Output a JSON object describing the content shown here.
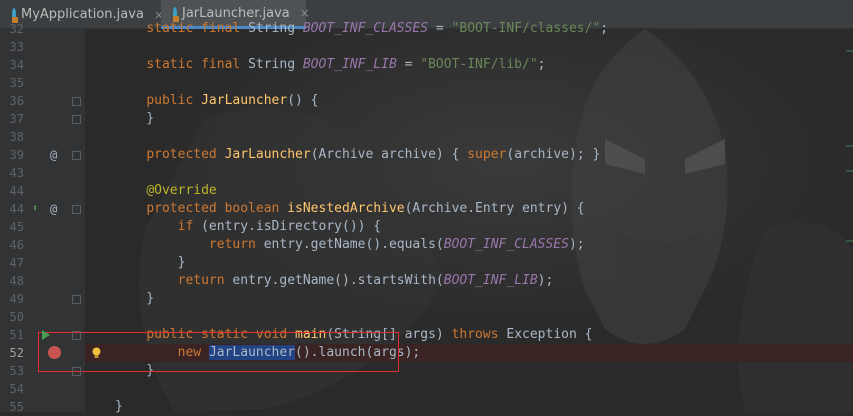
{
  "tabs": [
    {
      "label": "MyApplication.java",
      "close": "×",
      "active": false
    },
    {
      "label": "JarLauncher.java",
      "close": "×",
      "active": true
    }
  ],
  "gutter": {
    "override_marker": "@",
    "implements_marker": "⬆"
  },
  "lines": [
    {
      "num": "32",
      "parts": [
        [
          "plain",
          "    "
        ],
        [
          "kw",
          "static final "
        ],
        [
          "typ",
          "String "
        ],
        [
          "fld",
          "BOOT_INF_CLASSES"
        ],
        [
          "plain",
          " = "
        ],
        [
          "str",
          "\"BOOT-INF/classes/\""
        ],
        [
          "plain",
          ";"
        ]
      ]
    },
    {
      "num": "33",
      "parts": []
    },
    {
      "num": "34",
      "parts": [
        [
          "plain",
          "    "
        ],
        [
          "kw",
          "static final "
        ],
        [
          "typ",
          "String "
        ],
        [
          "fld",
          "BOOT_INF_LIB"
        ],
        [
          "plain",
          " = "
        ],
        [
          "str",
          "\"BOOT-INF/lib/\""
        ],
        [
          "plain",
          ";"
        ]
      ]
    },
    {
      "num": "35",
      "parts": []
    },
    {
      "num": "36",
      "parts": [
        [
          "plain",
          "    "
        ],
        [
          "kw",
          "public "
        ],
        [
          "mth",
          "JarLauncher"
        ],
        [
          "plain",
          "() {"
        ]
      ]
    },
    {
      "num": "37",
      "parts": [
        [
          "plain",
          "    }"
        ]
      ]
    },
    {
      "num": "38",
      "parts": []
    },
    {
      "num": "39",
      "parts": [
        [
          "plain",
          "    "
        ],
        [
          "kw",
          "protected "
        ],
        [
          "mth",
          "JarLauncher"
        ],
        [
          "plain",
          "(Archive archive) { "
        ],
        [
          "kw",
          "super"
        ],
        [
          "plain",
          "(archive); }"
        ]
      ]
    },
    {
      "num": "43",
      "parts": []
    },
    {
      "num": "44",
      "parts": [
        [
          "plain",
          "    "
        ],
        [
          "ann",
          "@Override"
        ]
      ]
    },
    {
      "num": "44",
      "parts": [
        [
          "plain",
          "    "
        ],
        [
          "kw",
          "protected boolean "
        ],
        [
          "mth",
          "isNestedArchive"
        ],
        [
          "plain",
          "(Archive.Entry entry) {"
        ]
      ]
    },
    {
      "num": "45",
      "parts": [
        [
          "plain",
          "        "
        ],
        [
          "kw",
          "if "
        ],
        [
          "plain",
          "(entry.isDirectory()) {"
        ]
      ]
    },
    {
      "num": "46",
      "parts": [
        [
          "plain",
          "            "
        ],
        [
          "kw",
          "return "
        ],
        [
          "plain",
          "entry.getName().equals("
        ],
        [
          "fld",
          "BOOT_INF_CLASSES"
        ],
        [
          "plain",
          ");"
        ]
      ]
    },
    {
      "num": "47",
      "parts": [
        [
          "plain",
          "        }"
        ]
      ]
    },
    {
      "num": "48",
      "parts": [
        [
          "plain",
          "        "
        ],
        [
          "kw",
          "return "
        ],
        [
          "plain",
          "entry.getName().startsWith("
        ],
        [
          "fld",
          "BOOT_INF_LIB"
        ],
        [
          "plain",
          ");"
        ]
      ]
    },
    {
      "num": "49",
      "parts": [
        [
          "plain",
          "    }"
        ]
      ]
    },
    {
      "num": "50",
      "parts": []
    },
    {
      "num": "51",
      "parts": [
        [
          "plain",
          "    "
        ],
        [
          "kw",
          "public static void "
        ],
        [
          "mth",
          "main"
        ],
        [
          "plain",
          "(String[] args) "
        ],
        [
          "kw",
          "throws "
        ],
        [
          "plain",
          "Exception {"
        ]
      ]
    },
    {
      "num": "52",
      "parts": [
        [
          "plain",
          "        "
        ],
        [
          "kw",
          "new "
        ],
        [
          "hl",
          "JarLauncher"
        ],
        [
          "plain",
          "().launch(args);"
        ]
      ]
    },
    {
      "num": "53",
      "parts": [
        [
          "plain",
          "    }"
        ]
      ]
    },
    {
      "num": "54",
      "parts": []
    },
    {
      "num": "55",
      "parts": [
        [
          "plain",
          "}"
        ]
      ]
    }
  ],
  "colors": {
    "keyword": "#cc7832",
    "field": "#9876aa",
    "string": "#6a8759",
    "annotation": "#bbb529",
    "method": "#ffc66d",
    "breakpoint": "#c75450",
    "highlight_box": "#e0312f"
  },
  "icons": {
    "breakpoint": "breakpoint-icon",
    "run": "run-arrow-icon",
    "intention": "lightbulb-icon",
    "file": "java-class-icon",
    "close": "close-icon"
  }
}
